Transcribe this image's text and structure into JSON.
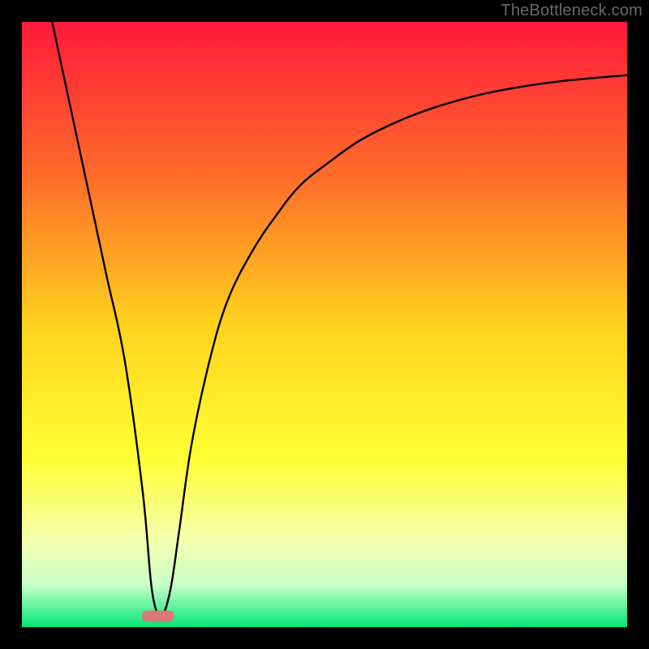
{
  "attribution": "TheBottleneck.com",
  "chart_data": {
    "type": "line",
    "title": "",
    "xlabel": "",
    "ylabel": "",
    "xlim": [
      0,
      100
    ],
    "ylim": [
      0,
      100
    ],
    "gradient_stops": [
      {
        "offset": 0,
        "color": "#ff1a3c"
      },
      {
        "offset": 25,
        "color": "#ff6a2a"
      },
      {
        "offset": 50,
        "color": "#ffd21e"
      },
      {
        "offset": 72,
        "color": "#ffff33"
      },
      {
        "offset": 86,
        "color": "#f4ffb0"
      },
      {
        "offset": 93,
        "color": "#c8ffc8"
      },
      {
        "offset": 100,
        "color": "#00e676"
      }
    ],
    "marker": {
      "x": 22.5,
      "y": 1.8,
      "color": "#d97a7a"
    },
    "series": [
      {
        "name": "curve",
        "x": [
          5,
          8,
          11,
          14,
          17,
          20,
          21.5,
          23,
          24.5,
          26,
          28,
          31,
          34,
          38,
          42,
          46,
          51,
          56,
          62,
          68,
          75,
          82,
          90,
          100
        ],
        "y": [
          100,
          86,
          72,
          58,
          44,
          22,
          6,
          2,
          6,
          16,
          30,
          44,
          54,
          62,
          68,
          73,
          77,
          80.5,
          83.5,
          85.8,
          87.8,
          89.2,
          90.3,
          91.2
        ]
      }
    ]
  }
}
